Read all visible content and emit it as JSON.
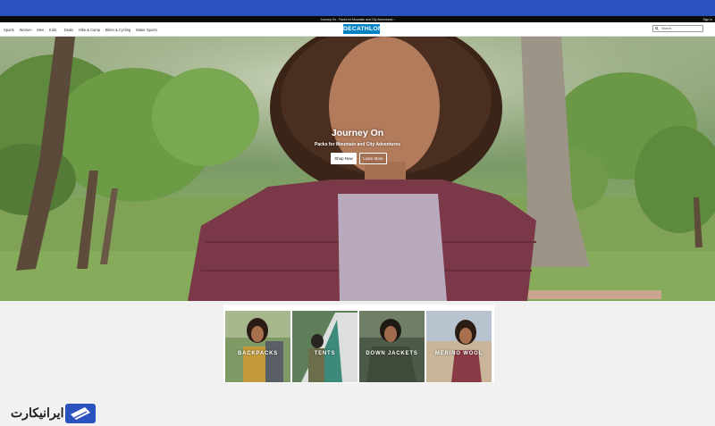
{
  "colors": {
    "topbar": "#2a52be",
    "brand": "#0082c3",
    "announce_bg": "#0a0a0a"
  },
  "announcement": {
    "message": "Journey On - Packs for Mountain and City Adventures  ›",
    "sign_in": "Sign In"
  },
  "nav": {
    "links": [
      "Sports",
      "Women",
      "Men",
      "Kids",
      "Deals",
      "Hike & Camp",
      "Bikes & Cycling",
      "Water Sports"
    ],
    "logo": "DECATHLON",
    "search_placeholder": "Search",
    "search_icon": "search-icon"
  },
  "hero": {
    "title": "Journey On",
    "subtitle": "Packs for Mountain and City Adventures",
    "primary_button": "Shop Now",
    "secondary_button": "Learn More"
  },
  "categories": [
    {
      "label": "BACKPACKS"
    },
    {
      "label": "TENTS"
    },
    {
      "label": "DOWN JACKETS"
    },
    {
      "label": "MERINO WOOL"
    }
  ],
  "watermark": {
    "text": "ایرانیکارت"
  }
}
